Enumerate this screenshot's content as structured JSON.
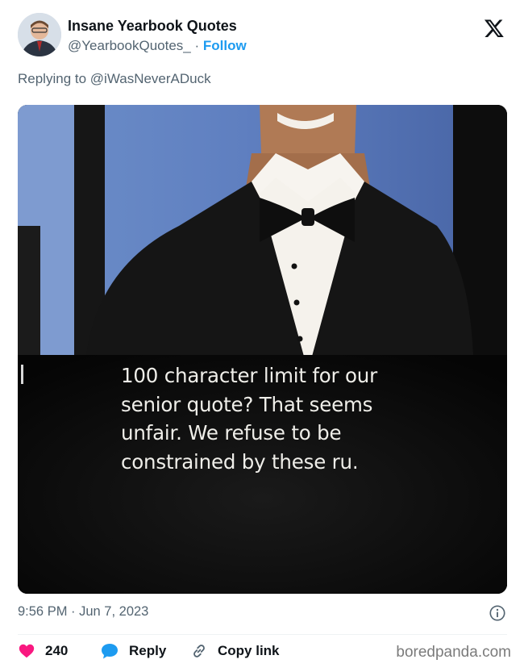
{
  "tweet": {
    "author_name": "Insane Yearbook Quotes",
    "author_handle": "@YearbookQuotes_",
    "separator": "·",
    "follow_label": "Follow",
    "replying_prefix": "Replying to",
    "replying_to": "@iWasNeverADuck",
    "image_caption_lines": [
      "100 character limit for our",
      "senior quote? That seems",
      "unfair. We refuse to be",
      "constrained by these ru."
    ],
    "timestamp": "9:56 PM · Jun 7, 2023",
    "likes_count": "240",
    "reply_label": "Reply",
    "copy_link_label": "Copy link"
  },
  "watermark": "boredpanda.com",
  "colors": {
    "accent": "#1d9bf0",
    "like": "#f91880",
    "muted": "#536471"
  },
  "icons": {
    "logo": "x-logo-icon",
    "info": "info-icon",
    "like": "heart-icon",
    "reply": "speech-bubble-icon",
    "copy": "link-icon"
  }
}
